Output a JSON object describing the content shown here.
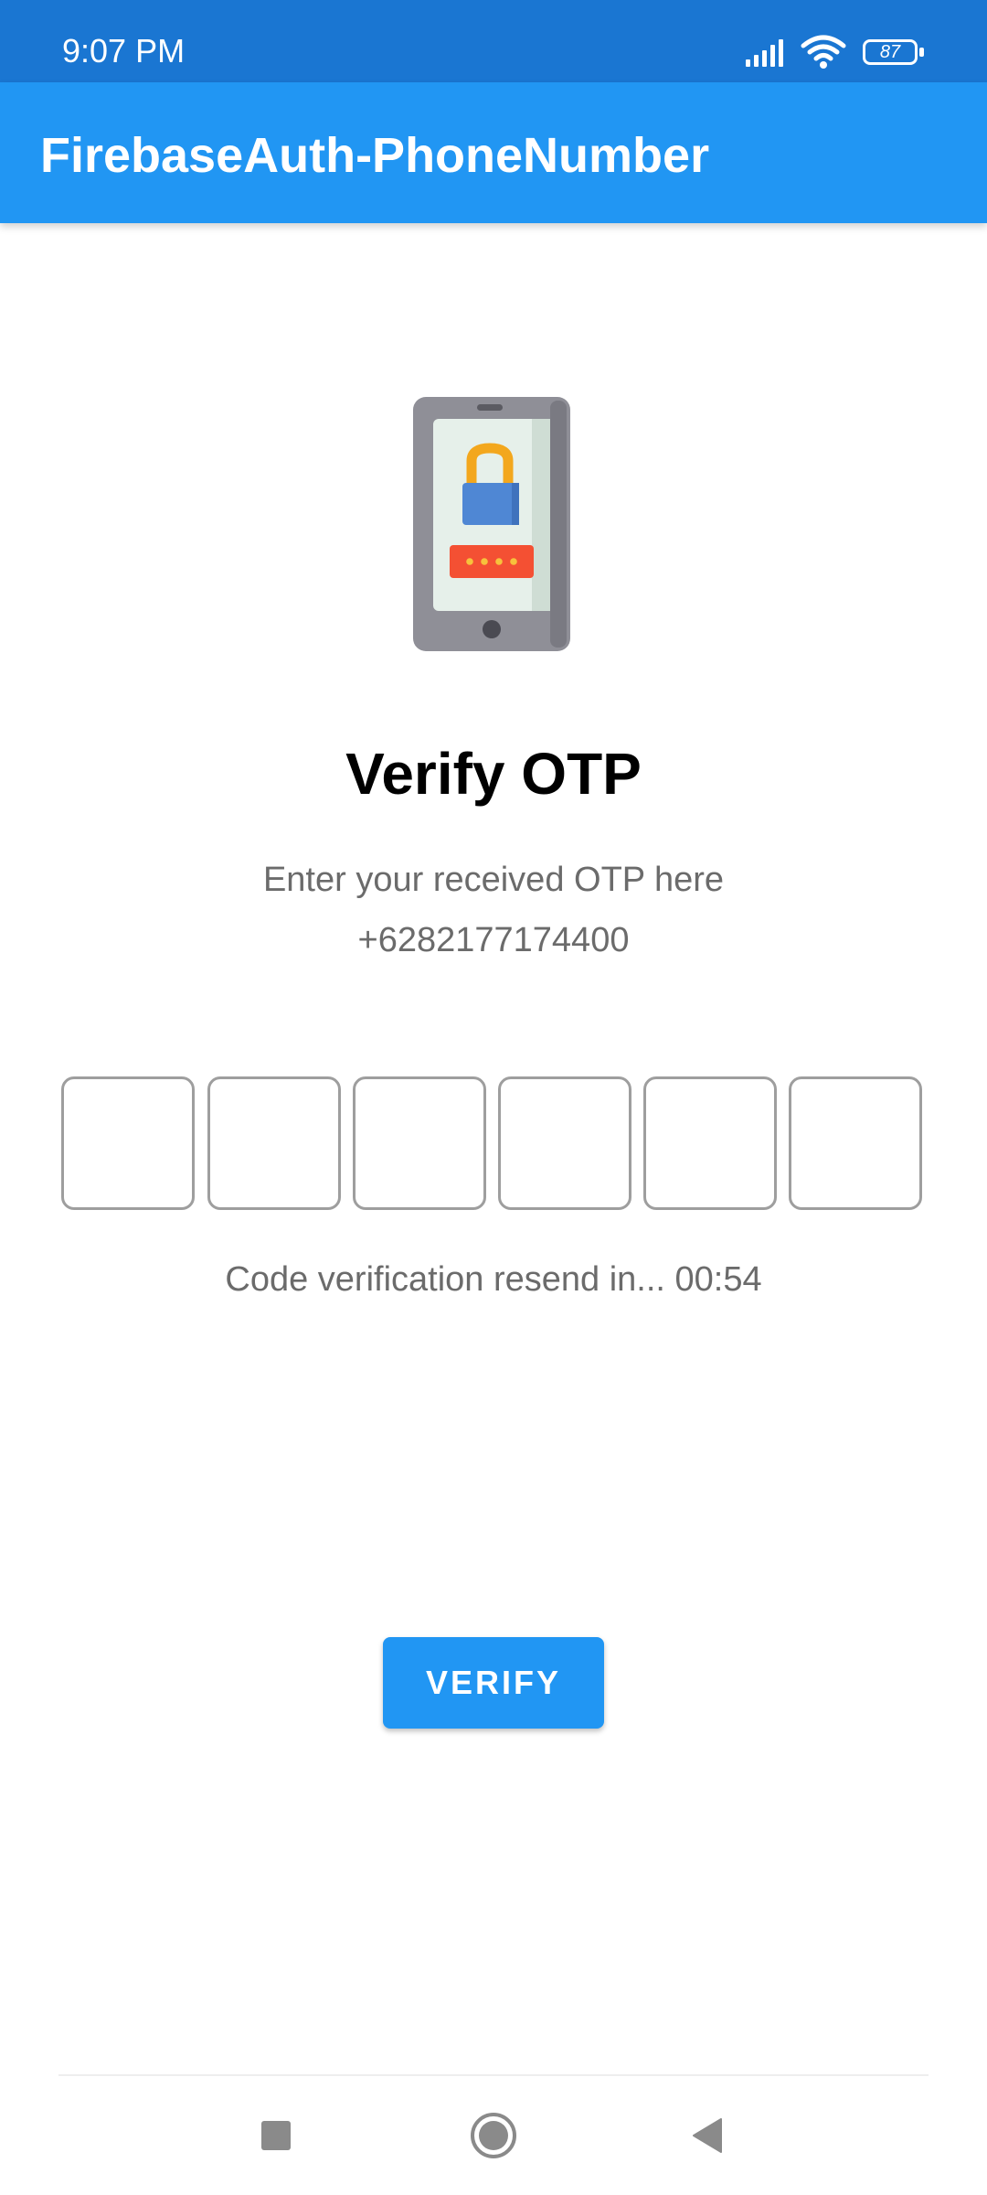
{
  "status_bar": {
    "time": "9:07 PM",
    "battery_level": "87",
    "icons": [
      "signal-icon",
      "wifi-icon",
      "battery-icon"
    ]
  },
  "app_bar": {
    "title": "FirebaseAuth-PhoneNumber"
  },
  "illustration": {
    "icon": "phone-lock-icon"
  },
  "main": {
    "title": "Verify OTP",
    "subtitle": "Enter your received OTP here",
    "phone_number": "+6282177174400",
    "otp_digits": [
      "",
      "",
      "",
      "",
      "",
      ""
    ],
    "resend_text": "Code verification resend in... 00:54",
    "verify_label": "VERIFY"
  },
  "nav_bar": {
    "icons": [
      "recents-square-icon",
      "home-circle-icon",
      "back-triangle-icon"
    ]
  },
  "colors": {
    "status_bar": "#1a76d2",
    "app_bar": "#2196f3",
    "button": "#2196f3",
    "text_secondary": "#6b6b6b",
    "otp_border": "#9e9e9e"
  }
}
